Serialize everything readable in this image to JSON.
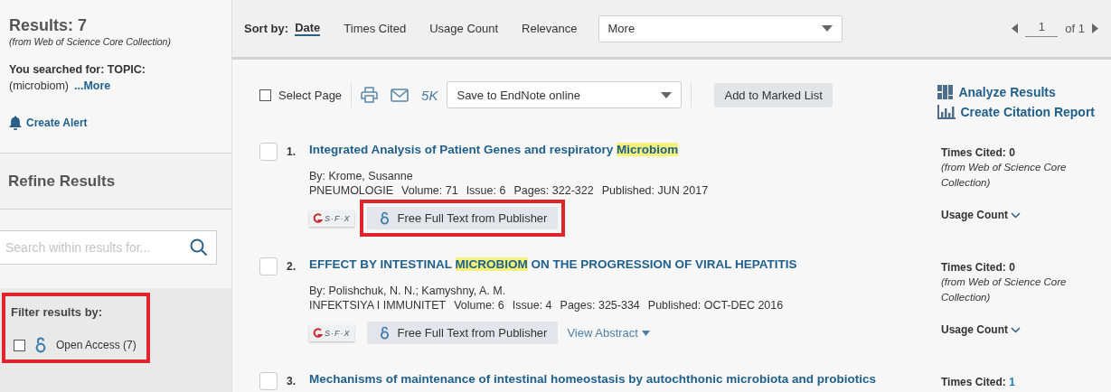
{
  "sidebar": {
    "results_title": "Results: 7",
    "results_source": "(from Web of Science Core Collection)",
    "searched_for": "You searched for: TOPIC:",
    "query": "(microbiom)",
    "more_link": "...More",
    "create_alert": "Create Alert",
    "refine_title": "Refine Results",
    "search": {
      "placeholder": "Search within results for..."
    },
    "filter_title": "Filter results by:",
    "filter_highlighted": true,
    "filters": [
      {
        "label": "Open Access (7)",
        "checked": false
      }
    ]
  },
  "sort": {
    "label": "Sort by:",
    "options": [
      {
        "label": "Date",
        "selected": true
      },
      {
        "label": "Times Cited",
        "selected": false
      },
      {
        "label": "Usage Count",
        "selected": false
      },
      {
        "label": "Relevance",
        "selected": false
      }
    ],
    "more": "More"
  },
  "pagination": {
    "page": "1",
    "of": "of 1"
  },
  "toolbar": {
    "select_page": "Select Page",
    "select_checked": false,
    "count": "5K",
    "save_to": "Save to EndNote online",
    "add_to_list": "Add to Marked List",
    "analyze": "Analyze Results",
    "citation_report": "Create Citation Report"
  },
  "records": [
    {
      "number": "1.",
      "checked": false,
      "title": [
        {
          "text": "Integrated Analysis of Patient Genes and respiratory ",
          "highlighted": false
        },
        {
          "text": "Microbiom",
          "highlighted": true
        }
      ],
      "authors": "By: Krome, Susanne",
      "source": [
        {
          "text": "PNEUMOLOGIE"
        },
        {
          "text": "Volume: 71"
        },
        {
          "text": "Issue: 6"
        },
        {
          "text": "Pages: 322-322"
        },
        {
          "text": "Published: JUN 2017"
        }
      ],
      "sfx": "S·F·X",
      "full_text": "Free Full Text from Publisher",
      "full_text_highlighted": true,
      "times_cited": "Times Cited: ",
      "times_cited_value": "0",
      "times_cited_linked": false,
      "cited_source": "(from Web of Science Core Collection)",
      "usage_count": "Usage Count"
    },
    {
      "number": "2.",
      "checked": false,
      "title": [
        {
          "text": "EFFECT BY INTESTINAL ",
          "highlighted": false
        },
        {
          "text": "MICROBIOM",
          "highlighted": true
        },
        {
          "text": " ON THE PROGRESSION OF VIRAL HEPATITIS",
          "highlighted": false
        }
      ],
      "authors": "By: Polishchuk, N. N.; Kamyshny, A. M.",
      "source": [
        {
          "text": "INFEKTSIYA I IMMUNITET"
        },
        {
          "text": "Volume: 6"
        },
        {
          "text": "Issue: 4"
        },
        {
          "text": "Pages: 325-334"
        },
        {
          "text": "Published: OCT-DEC 2016"
        }
      ],
      "sfx": "S·F·X",
      "full_text": "Free Full Text from Publisher",
      "full_text_highlighted": false,
      "view_abstract": "View Abstract",
      "times_cited": "Times Cited: ",
      "times_cited_value": "0",
      "times_cited_linked": false,
      "cited_source": "(from Web of Science Core Collection)",
      "usage_count": "Usage Count"
    },
    {
      "number": "3.",
      "checked": false,
      "title": [
        {
          "text": "Mechanisms of maintenance of intestinal homeostasis by autochthonic microbiota and probiotics",
          "highlighted": false
        }
      ],
      "times_cited": "Times Cited: ",
      "times_cited_value": "1",
      "times_cited_linked": true
    }
  ]
}
